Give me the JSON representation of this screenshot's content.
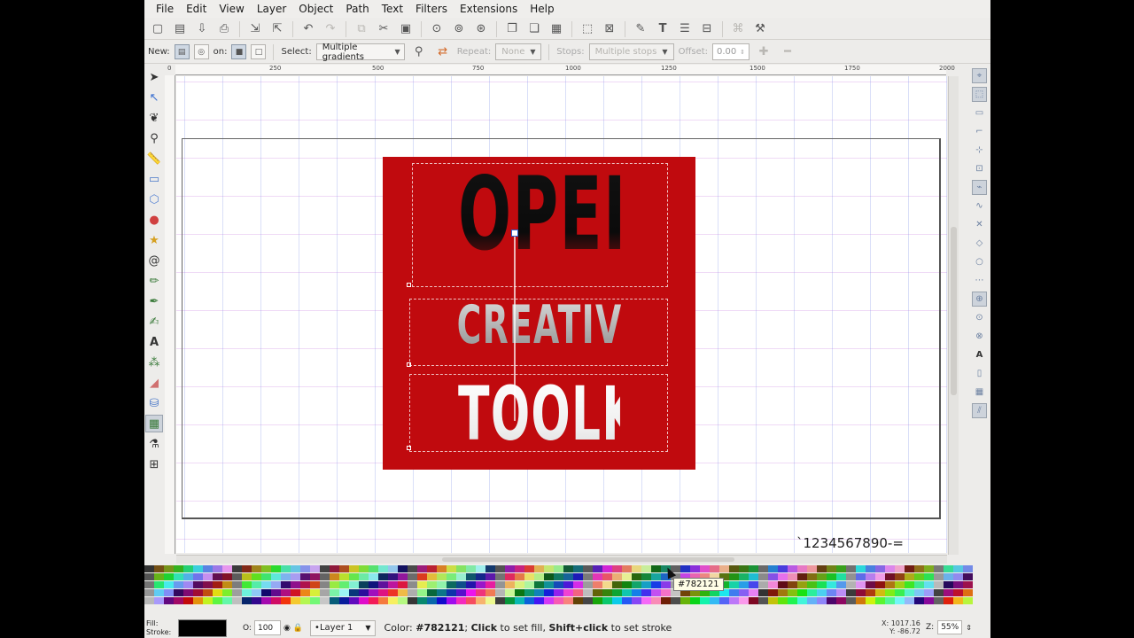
{
  "menu": [
    "File",
    "Edit",
    "View",
    "Layer",
    "Object",
    "Path",
    "Text",
    "Filters",
    "Extensions",
    "Help"
  ],
  "commands": {
    "icons": [
      "new-icon",
      "open-icon",
      "save-icon",
      "print-icon",
      "import-icon",
      "export-icon",
      "undo-icon",
      "redo-icon",
      "copy-icon",
      "cut-icon",
      "paste-icon",
      "zoom-selection-icon",
      "zoom-drawing-icon",
      "zoom-page-icon",
      "duplicate-icon",
      "clone-icon",
      "unlink-clone-icon",
      "group-icon",
      "ungroup-icon",
      "fill-stroke-icon",
      "text-font-icon",
      "layers-icon",
      "align-icon",
      "xml-editor-icon",
      "preferences-icon"
    ]
  },
  "gradient_controls": {
    "new_label": "New:",
    "on_label": "on:",
    "select_label": "Select:",
    "select_value": "Multiple gradients",
    "repeat_label": "Repeat:",
    "repeat_value": "None",
    "stops_label": "Stops:",
    "stops_value": "Multiple stops",
    "offset_label": "Offset:",
    "offset_value": "0.00"
  },
  "tools": [
    "selector-icon",
    "node-icon",
    "tweak-icon",
    "zoom-icon",
    "measure-icon",
    "rectangle-icon",
    "box3d-icon",
    "ellipse-icon",
    "star-icon",
    "spiral-icon",
    "pencil-icon",
    "pen-icon",
    "calligraphy-icon",
    "text-icon",
    "spray-icon",
    "eraser-icon",
    "paint-bucket-icon",
    "gradient-icon",
    "dropper-icon",
    "connector-icon"
  ],
  "active_tool": "gradient-icon",
  "ruler": {
    "top_labels": [
      "0",
      "250",
      "500",
      "750",
      "1000",
      "1250",
      "1500",
      "1750",
      "2000"
    ]
  },
  "artwork": {
    "background_color": "#c00a0e",
    "words": [
      "OPEN",
      "CREATIVE",
      "TOOLKIT"
    ]
  },
  "canvas_text": "`1234567890-=",
  "tooltip": "#782121",
  "status": {
    "fill_label": "Fill:",
    "stroke_label": "Stroke:",
    "fill_color": "#000000",
    "opacity_label": "O:",
    "opacity_value": "100",
    "layer": "•Layer 1",
    "message_prefix": "Color: ",
    "message_color": "#782121",
    "message_mid": "; ",
    "message_click": "Click",
    "message_rest1": " to set fill, ",
    "message_shift": "Shift+click",
    "message_rest2": " to set stroke",
    "coord_x": "X: 1017.16",
    "coord_y": "Y:   -86.72",
    "zoom_label": "Z:",
    "zoom_value": "55%"
  }
}
